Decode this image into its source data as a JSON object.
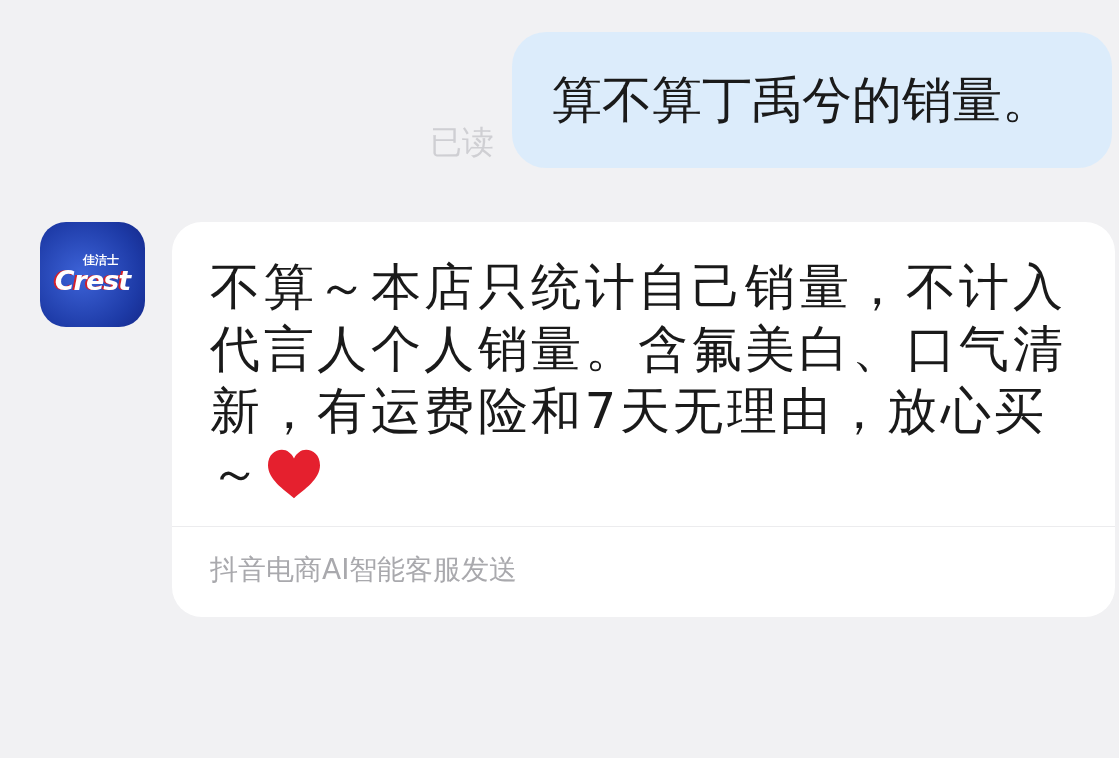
{
  "messages": [
    {
      "kind": "outgoing",
      "text": "算不算丁禹兮的销量。",
      "read_label": "已读"
    },
    {
      "kind": "incoming",
      "avatar": {
        "title": "佳洁士",
        "wordmark": "Crest"
      },
      "text": "不算～本店只统计自己销量，不计入代言人个人销量。含氟美白、口气清新，有运费险和7天无理由，放心买",
      "tail": "～",
      "footer": "抖音电商AI智能客服发送"
    }
  ]
}
